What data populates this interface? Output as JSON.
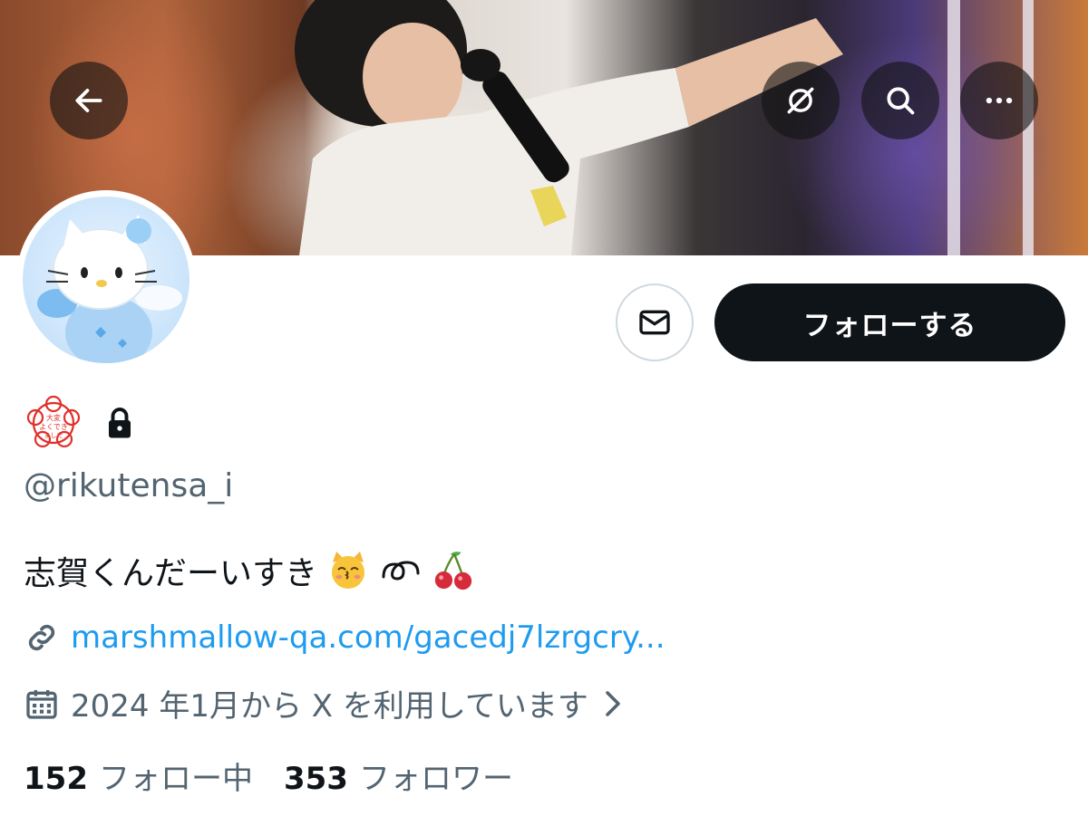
{
  "header": {
    "back_icon": "arrow-left-icon",
    "grok_icon": "grok-icon",
    "search_icon": "search-icon",
    "more_icon": "more-horizontal-icon"
  },
  "banner": {
    "description_icon": "concert-photo"
  },
  "profile": {
    "handle": "@rikutensa_i",
    "bio_text": "志賀くんだーいすき",
    "bio_emojis": [
      "kissing-cat-emoji",
      "loop-emoji",
      "cherries-emoji"
    ],
    "link": "marshmallow-qa.com/gacedj7lzrgcry...",
    "joined": "2024 年1月から X を利用しています",
    "stamp_text": "大変よくできました",
    "protected": true
  },
  "actions": {
    "message_icon": "envelope-icon",
    "follow_label": "フォローする"
  },
  "stats": {
    "following_count": "152",
    "following_label": "フォロー中",
    "followers_count": "353",
    "followers_label": "フォロワー"
  },
  "colors": {
    "accent_link": "#1d9bf0",
    "secondary_text": "#536471",
    "primary_text": "#0f1419",
    "follow_bg": "#0f1419",
    "stamp_red": "#e0302a"
  }
}
